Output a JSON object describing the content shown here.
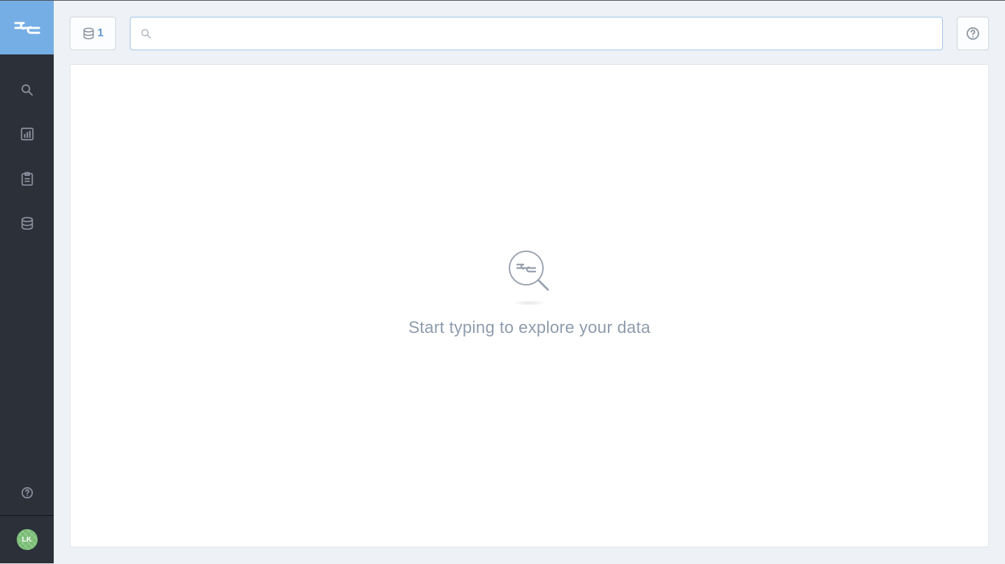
{
  "sidebar": {
    "logo_label": "Brand logo",
    "nav": {
      "search_label": "Search",
      "dashboards_label": "Dashboards",
      "reports_label": "Reports",
      "data_sources_label": "Data sources"
    },
    "help_label": "Help",
    "avatar_initials": "LK"
  },
  "topbar": {
    "data_source": {
      "label": "Selected data sources",
      "count": "1"
    },
    "search": {
      "value": "",
      "placeholder": ""
    },
    "help_label": "Help"
  },
  "empty_state": {
    "message": "Start typing to explore your data"
  },
  "colors": {
    "brand_blue": "#75aee4",
    "sidebar_bg": "#2b3039",
    "avatar_green": "#7ec27a"
  }
}
